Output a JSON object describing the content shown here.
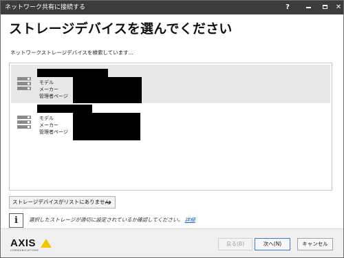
{
  "window": {
    "title": "ネットワーク共有に接続する",
    "controls": {
      "help": "?"
    }
  },
  "heading": "ストレージデバイスを選んでください",
  "status_text": "ネットワークストレージデバイスを検索しています...",
  "devices": [
    {
      "icon": "server-icon",
      "model_label": "モデル",
      "maker_label": "メーカー",
      "admin_label": "管理者ページ",
      "selected": true
    },
    {
      "icon": "server-icon",
      "model_label": "モデル",
      "maker_label": "メーカー",
      "admin_label": "管理者ページ",
      "selected": false
    }
  ],
  "not_listed_button": {
    "label": "ストレージデバイスがリストにありません",
    "icon": "arrow-right-icon"
  },
  "info": {
    "icon": "info-icon",
    "text": "選択したストレージが適切に設定されているか確認してください。",
    "link": "詳細"
  },
  "footer": {
    "logo_text": "AXIS",
    "logo_subtext": "COMMUNICATIONS",
    "back_label": "戻る(B)",
    "next_label": "次へ(N)",
    "cancel_label": "キャンセル"
  },
  "colors": {
    "titlebar": "#3c3c3c",
    "selection": "#e8e8e8",
    "link": "#1a5fb4",
    "logo_accent": "#f5c400"
  }
}
